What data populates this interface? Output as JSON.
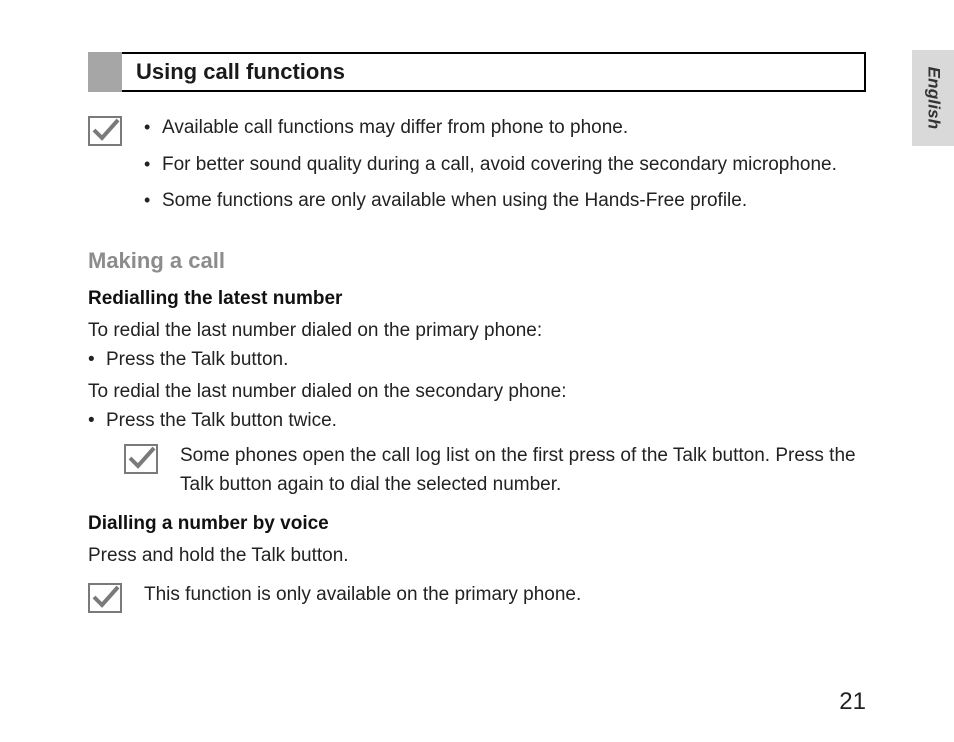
{
  "language_tab": "English",
  "heading": "Using call functions",
  "note1": {
    "items": [
      "Available call functions may differ from phone to phone.",
      "For better sound quality during a call, avoid covering the secondary microphone.",
      "Some functions are only available when using the Hands-Free profile."
    ]
  },
  "section": {
    "title": "Making a call",
    "sub1": {
      "title": "Redialling the latest number",
      "intro_primary": "To redial the  last number dialed on the primary phone:",
      "step_primary": "Press the Talk button.",
      "intro_secondary": "To redial the last number dialed on the secondary phone:",
      "step_secondary": "Press the Talk button twice.",
      "note": "Some phones open the call log list on the first press of the Talk button. Press the Talk button again to dial the selected number."
    },
    "sub2": {
      "title": "Dialling a number by voice",
      "body": "Press and hold the Talk button.",
      "note": "This function is only available on the primary phone."
    }
  },
  "page_number": "21"
}
